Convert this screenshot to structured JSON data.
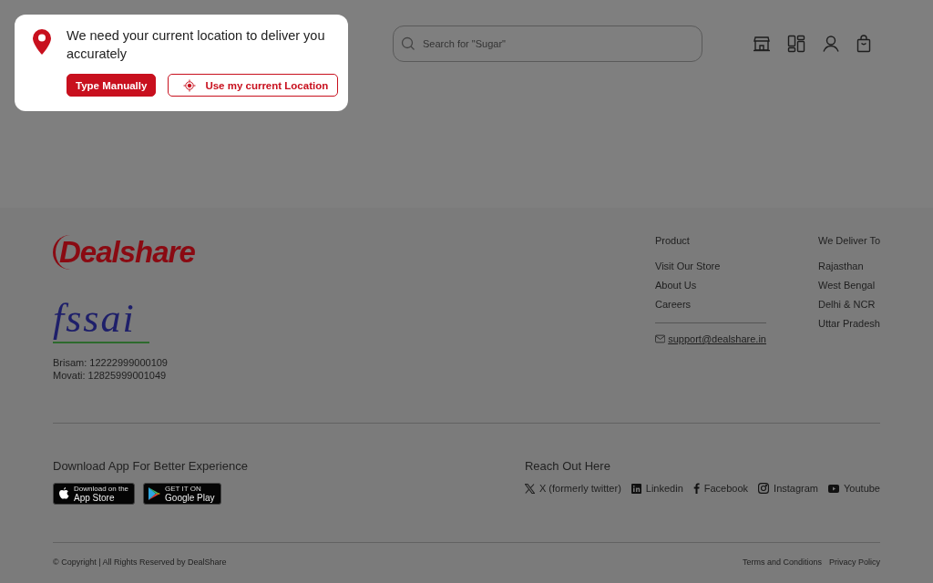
{
  "header": {
    "search": {
      "placeholder": "Search for \"Sugar\""
    }
  },
  "location_popup": {
    "message": "We need your current location to deliver you accurately",
    "buttons": [
      {
        "label": "Type Manually",
        "kind": "primary"
      },
      {
        "label": "Use my current Location",
        "kind": "outline"
      }
    ]
  },
  "footer": {
    "logo": "Dealshare",
    "fssai_logo": "fssai",
    "licenses": [
      "Brisam: 12222999000109",
      "Movati: 12825999001049"
    ],
    "product": {
      "title": "Product",
      "links": [
        "Visit Our Store",
        "About Us",
        "Careers"
      ],
      "email": "support@dealshare.in"
    },
    "deliver_to": {
      "title": "We Deliver To",
      "regions": [
        "Rajasthan",
        "West Bengal",
        "Delhi & NCR",
        "Uttar Pradesh"
      ]
    },
    "download": {
      "title": "Download App For Better Experience",
      "badges": [
        {
          "kind": "apple",
          "small": "Download on the",
          "label": "App Store"
        },
        {
          "kind": "google",
          "small": "GET IT ON",
          "label": "Google Play"
        }
      ]
    },
    "social": {
      "title": "Reach Out Here",
      "links": [
        {
          "kind": "x",
          "label": "X (formerly twitter)"
        },
        {
          "kind": "linkedin",
          "label": "Linkedin"
        },
        {
          "kind": "facebook",
          "label": "Facebook"
        },
        {
          "kind": "instagram",
          "label": "Instagram"
        },
        {
          "kind": "youtube",
          "label": "Youtube"
        }
      ]
    },
    "copyright": "© Copyright | All Rights Reserved by DealShare",
    "legal_links": [
      "Terms and Conditions",
      "Privacy Policy"
    ]
  }
}
